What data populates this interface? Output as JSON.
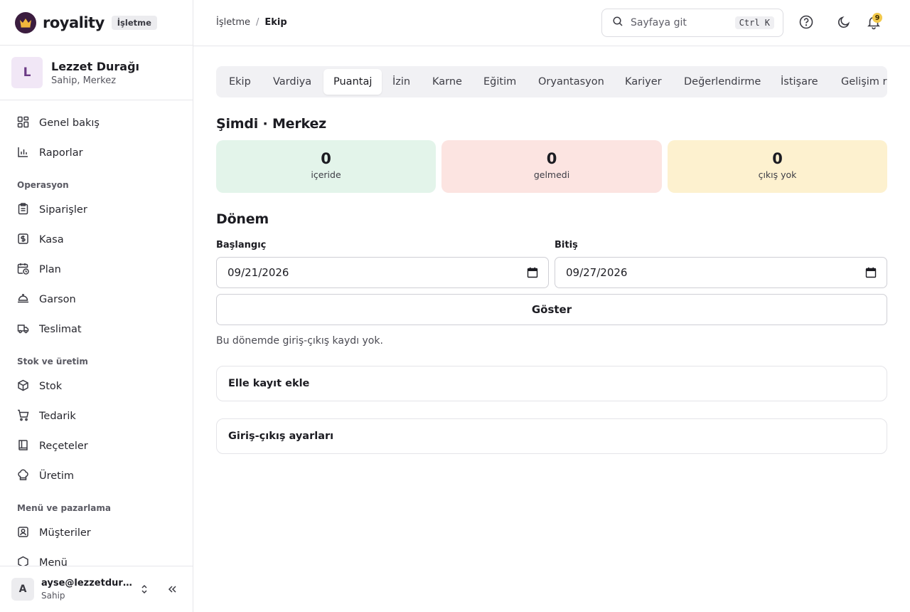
{
  "brand": {
    "name": "royality",
    "badge": "İşletme"
  },
  "org": {
    "initial": "L",
    "name": "Lezzet Durağı",
    "subtitle": "Sahip, Merkez"
  },
  "nav": {
    "top": [
      {
        "label": "Genel bakış",
        "icon": "dashboard-icon"
      },
      {
        "label": "Raporlar",
        "icon": "bar-chart-icon"
      }
    ],
    "sections": [
      {
        "title": "Operasyon",
        "items": [
          {
            "label": "Siparişler",
            "icon": "clipboard-icon"
          },
          {
            "label": "Kasa",
            "icon": "cash-register-icon"
          },
          {
            "label": "Plan",
            "icon": "calendar-clock-icon"
          },
          {
            "label": "Garson",
            "icon": "cloche-icon"
          },
          {
            "label": "Teslimat",
            "icon": "truck-icon"
          }
        ]
      },
      {
        "title": "Stok ve üretim",
        "items": [
          {
            "label": "Stok",
            "icon": "box-icon"
          },
          {
            "label": "Tedarik",
            "icon": "cart-icon"
          },
          {
            "label": "Reçeteler",
            "icon": "recipe-book-icon"
          },
          {
            "label": "Üretim",
            "icon": "chef-hat-icon"
          }
        ]
      },
      {
        "title": "Menü ve pazarlama",
        "items": [
          {
            "label": "Müşteriler",
            "icon": "user-card-icon"
          },
          {
            "label": "Menü",
            "icon": "menu-icon"
          }
        ]
      }
    ]
  },
  "user": {
    "initial": "A",
    "email": "ayse@lezzetduragi.com",
    "role": "Sahip"
  },
  "breadcrumb": {
    "parent": "İşletme",
    "separator": "/",
    "current": "Ekip"
  },
  "search": {
    "placeholder": "Sayfaya git",
    "shortcut": "Ctrl K"
  },
  "notifications": {
    "count": "9"
  },
  "tabs": [
    "Ekip",
    "Vardiya",
    "Puantaj",
    "İzin",
    "Karne",
    "Eğitim",
    "Oryantasyon",
    "Kariyer",
    "Değerlendirme",
    "İstişare",
    "Gelişim raporu"
  ],
  "active_tab": "Puantaj",
  "now": {
    "title": "Şimdi · Merkez",
    "stats": [
      {
        "value": "0",
        "label": "içeride",
        "bg": "#e3f4ea"
      },
      {
        "value": "0",
        "label": "gelmedi",
        "bg": "#fce4e1"
      },
      {
        "value": "0",
        "label": "çıkış yok",
        "bg": "#fdf1cf"
      }
    ]
  },
  "period": {
    "title": "Dönem",
    "start_label": "Başlangıç",
    "start_value": "09/21/2026",
    "end_label": "Bitiş",
    "end_value": "09/27/2026",
    "show_button": "Göster",
    "empty_message": "Bu dönemde giriş-çıkış kaydı yok."
  },
  "cards": {
    "manual_entry": "Elle kayıt ekle",
    "settings": "Giriş-çıkış ayarları"
  }
}
